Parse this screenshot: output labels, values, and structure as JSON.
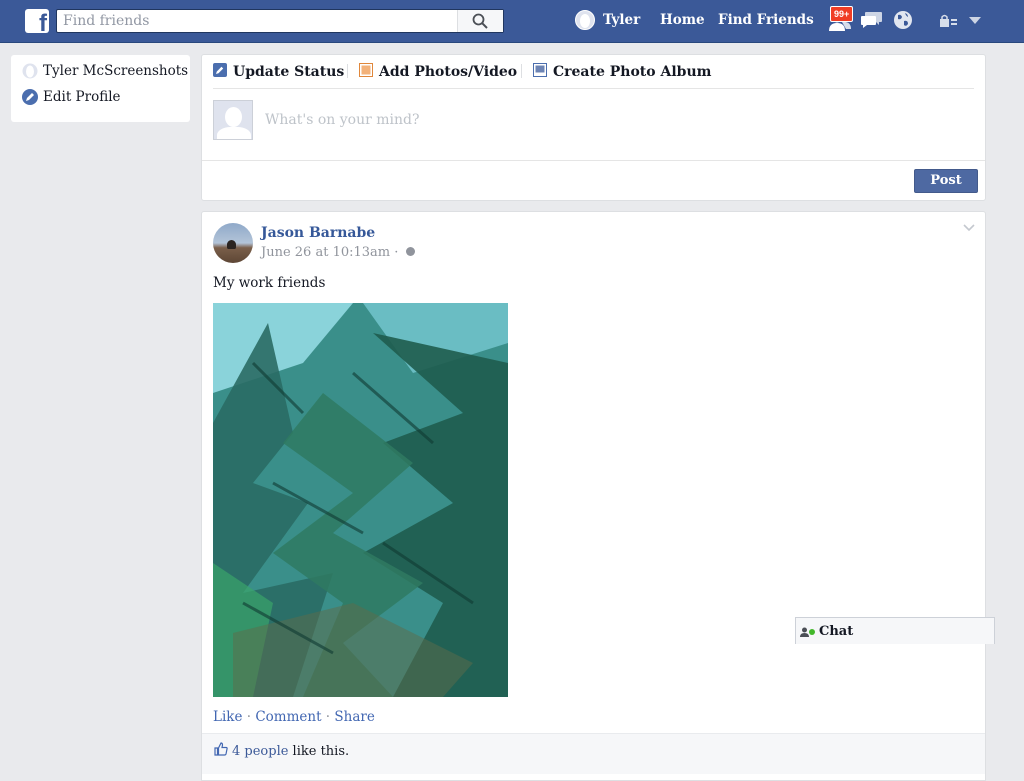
{
  "topbar": {
    "search_placeholder": "Find friends",
    "user_name": "Tyler",
    "home_label": "Home",
    "find_friends_label": "Find Friends",
    "friend_requests_badge": "99+"
  },
  "sidebar": {
    "items": [
      {
        "label": "Tyler McScreenshots",
        "icon": "profile-avatar-icon"
      },
      {
        "label": "Edit Profile",
        "icon": "pencil-icon"
      }
    ]
  },
  "composer": {
    "tabs": [
      {
        "label": "Update Status",
        "icon": "pencil-icon"
      },
      {
        "label": "Add Photos/Video",
        "icon": "photo-icon"
      },
      {
        "label": "Create Photo Album",
        "icon": "album-icon"
      }
    ],
    "placeholder": "What's on your mind?",
    "post_label": "Post"
  },
  "story": {
    "author": "Jason Barnabe",
    "timestamp": "June 26 at 10:13am ·",
    "text": "My work friends",
    "actions": {
      "like": "Like",
      "comment": "Comment",
      "share": "Share",
      "separator": " · "
    },
    "likes": {
      "count_label": "4 people",
      "suffix": " like this."
    }
  },
  "chat": {
    "label": "Chat"
  },
  "colors": {
    "brand_blue": "#3b5998",
    "link_blue": "#365899",
    "page_background": "#e9eaed",
    "badge_red": "#f03d25",
    "online_green": "#42b72a"
  }
}
